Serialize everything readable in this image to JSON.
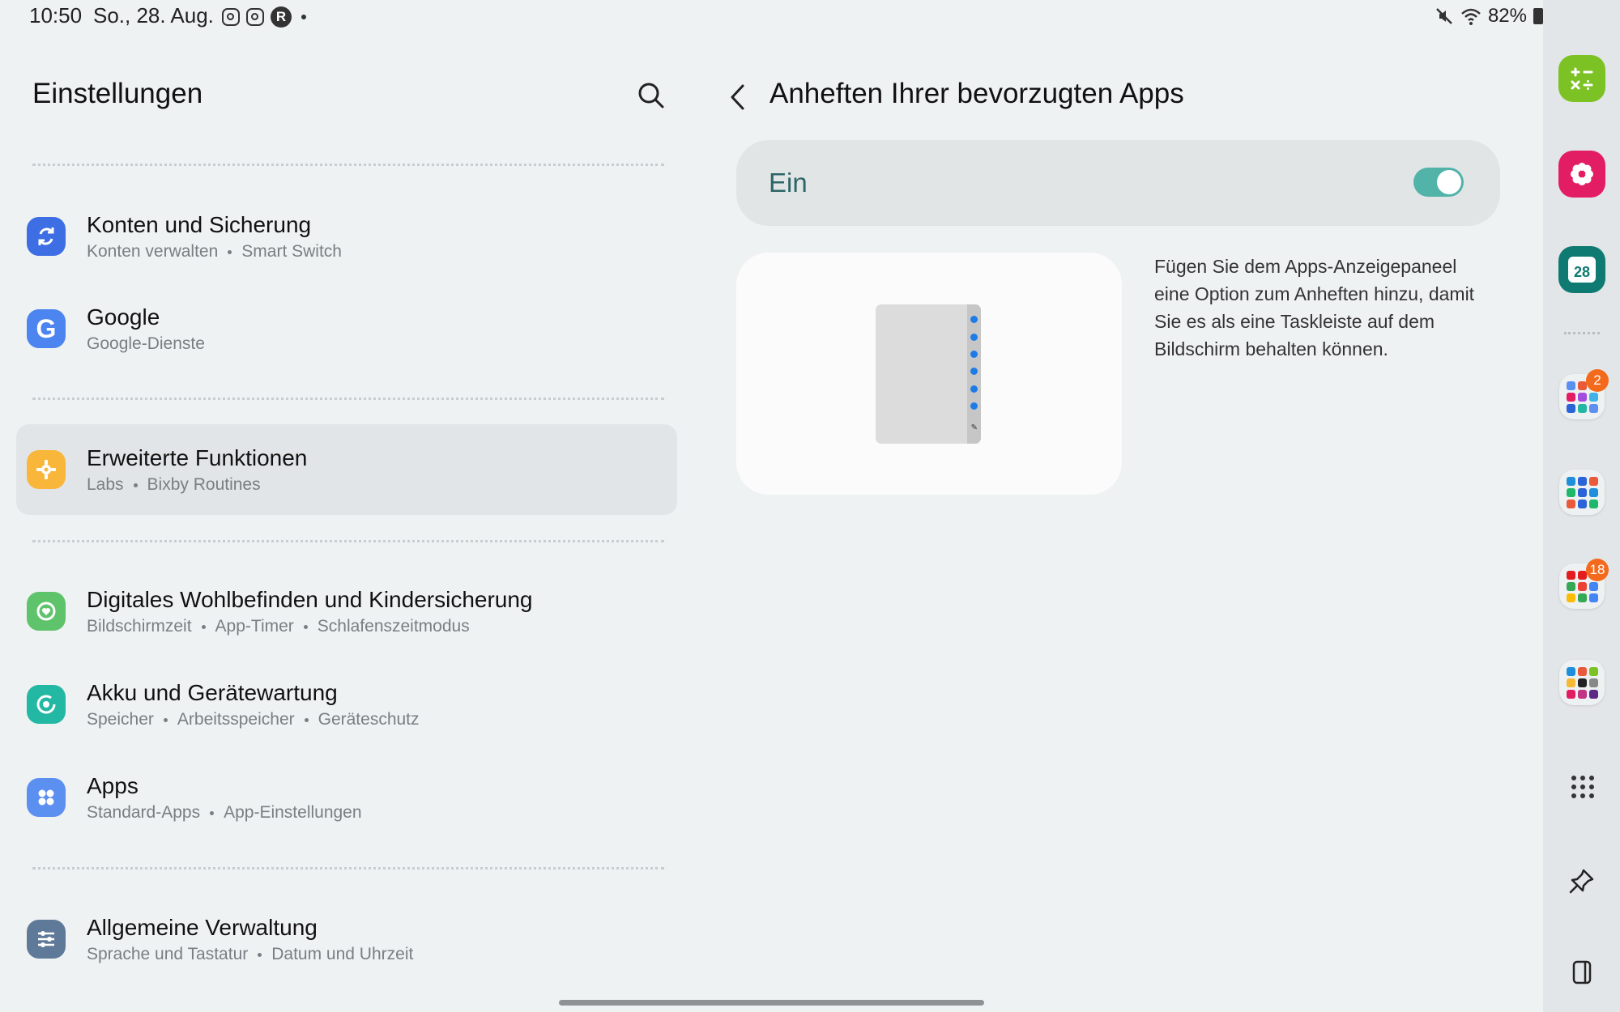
{
  "status_bar": {
    "time": "10:50",
    "date": "So., 28. Aug.",
    "notification_icons": [
      "instagram-icon",
      "instagram-icon",
      "r-app-icon",
      "more-dot-icon"
    ],
    "battery": "82%",
    "right_icons": [
      "mute-icon",
      "wifi-icon",
      "battery-icon"
    ]
  },
  "settings": {
    "title": "Einstellungen",
    "items": [
      {
        "title": "Konten und Sicherung",
        "subtitle": [
          "Konten verwalten",
          "Smart Switch"
        ],
        "icon": "sync-icon",
        "color": "#3d6ee3"
      },
      {
        "title": "Google",
        "subtitle": [
          "Google-Dienste"
        ],
        "icon": "google-icon",
        "color": "#4c84f0"
      },
      {
        "title": "Erweiterte Funktionen",
        "subtitle": [
          "Labs",
          "Bixby Routines"
        ],
        "icon": "puzzle-gear-icon",
        "color": "#f8b63b",
        "active": true
      },
      {
        "title": "Digitales Wohlbefinden und Kindersicherung",
        "subtitle": [
          "Bildschirmzeit",
          "App-Timer",
          "Schlafenszeitmodus"
        ],
        "icon": "wellbeing-icon",
        "color": "#5ec36a"
      },
      {
        "title": "Akku und Gerätewartung",
        "subtitle": [
          "Speicher",
          "Arbeitsspeicher",
          "Geräteschutz"
        ],
        "icon": "device-care-icon",
        "color": "#22b8a3"
      },
      {
        "title": "Apps",
        "subtitle": [
          "Standard-Apps",
          "App-Einstellungen"
        ],
        "icon": "apps-icon",
        "color": "#5b8ff0"
      },
      {
        "title": "Allgemeine Verwaltung",
        "subtitle": [
          "Sprache und Tastatur",
          "Datum und Uhrzeit"
        ],
        "icon": "sliders-icon",
        "color": "#5f7a98"
      }
    ]
  },
  "detail": {
    "title": "Anheften Ihrer bevorzugten Apps",
    "toggle_label": "Ein",
    "toggle_on": true,
    "description": "Fügen Sie dem Apps-Anzeigepaneel eine Option zum Anheften hinzu, damit Sie es als eine Taskleiste auf dem Bildschirm behalten können."
  },
  "taskbar": {
    "apps": [
      {
        "name": "calculator-icon",
        "color": "#7dc224"
      },
      {
        "name": "gallery-icon",
        "color": "#e31d63"
      },
      {
        "name": "calendar-icon",
        "color": "#0e7a72",
        "text": "28"
      }
    ],
    "folders": [
      {
        "name": "app-folder-1",
        "badge": "2"
      },
      {
        "name": "app-folder-2",
        "badge": ""
      },
      {
        "name": "app-folder-3",
        "badge": "18"
      },
      {
        "name": "app-folder-4",
        "badge": ""
      }
    ]
  }
}
